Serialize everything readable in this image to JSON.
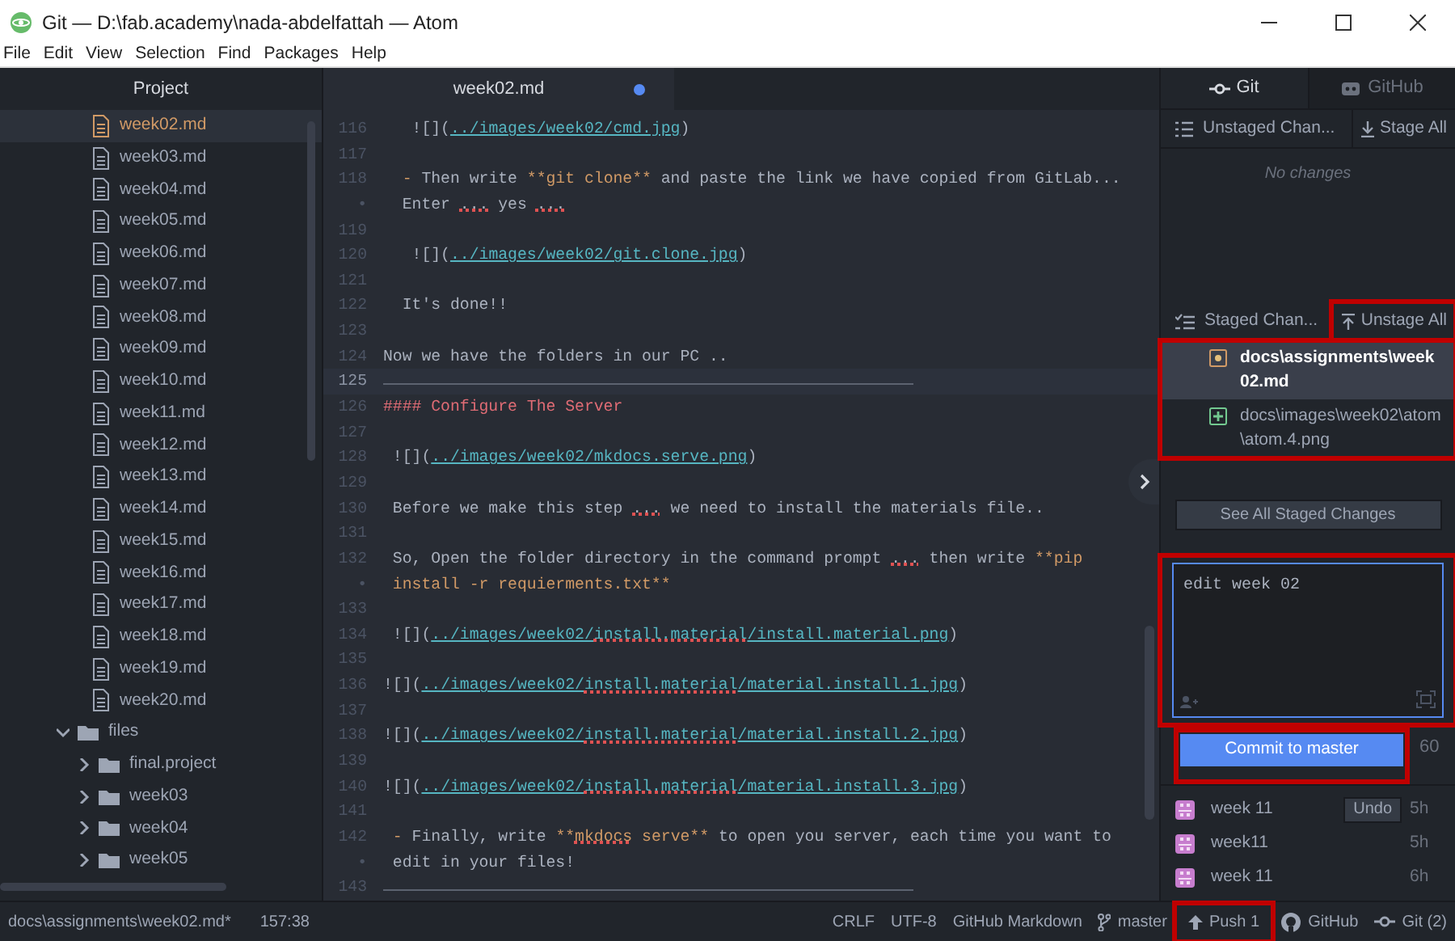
{
  "window": {
    "title": "Git — D:\\fab.academy\\nada-abdelfattah — Atom"
  },
  "menu": [
    "File",
    "Edit",
    "View",
    "Selection",
    "Find",
    "Packages",
    "Help"
  ],
  "project": {
    "title": "Project",
    "tree": [
      {
        "kind": "file",
        "label": "week02.md",
        "selected": true,
        "modified": true
      },
      {
        "kind": "file",
        "label": "week03.md",
        "selected": false,
        "modified": false
      },
      {
        "kind": "file",
        "label": "week04.md",
        "selected": false,
        "modified": false
      },
      {
        "kind": "file",
        "label": "week05.md",
        "selected": false,
        "modified": false
      },
      {
        "kind": "file",
        "label": "week06.md",
        "selected": false,
        "modified": false
      },
      {
        "kind": "file",
        "label": "week07.md",
        "selected": false,
        "modified": false
      },
      {
        "kind": "file",
        "label": "week08.md",
        "selected": false,
        "modified": false
      },
      {
        "kind": "file",
        "label": "week09.md",
        "selected": false,
        "modified": false
      },
      {
        "kind": "file",
        "label": "week10.md",
        "selected": false,
        "modified": false
      },
      {
        "kind": "file",
        "label": "week11.md",
        "selected": false,
        "modified": false
      },
      {
        "kind": "file",
        "label": "week12.md",
        "selected": false,
        "modified": false
      },
      {
        "kind": "file",
        "label": "week13.md",
        "selected": false,
        "modified": false
      },
      {
        "kind": "file",
        "label": "week14.md",
        "selected": false,
        "modified": false
      },
      {
        "kind": "file",
        "label": "week15.md",
        "selected": false,
        "modified": false
      },
      {
        "kind": "file",
        "label": "week16.md",
        "selected": false,
        "modified": false
      },
      {
        "kind": "file",
        "label": "week17.md",
        "selected": false,
        "modified": false
      },
      {
        "kind": "file",
        "label": "week18.md",
        "selected": false,
        "modified": false
      },
      {
        "kind": "file",
        "label": "week19.md",
        "selected": false,
        "modified": false
      },
      {
        "kind": "file",
        "label": "week20.md",
        "selected": false,
        "modified": false
      },
      {
        "kind": "folder",
        "label": "files",
        "expanded": true,
        "selected": false,
        "children": [
          {
            "kind": "folder",
            "label": "final.project",
            "expanded": false,
            "selected": false
          },
          {
            "kind": "folder",
            "label": "week03",
            "expanded": false,
            "selected": false
          },
          {
            "kind": "folder",
            "label": "week04",
            "expanded": false,
            "selected": false
          },
          {
            "kind": "folder",
            "label": "week05",
            "expanded": false,
            "selected": false
          }
        ]
      }
    ]
  },
  "editor": {
    "tab": {
      "label": "week02.md",
      "modified": true
    },
    "lines": [
      {
        "gutter": "116",
        "current": false,
        "segments": [
          {
            "kind": "text",
            "text": "   ![]("
          },
          {
            "kind": "link",
            "text": "../images/week02/cmd.jpg"
          },
          {
            "kind": "text",
            "text": ")"
          }
        ]
      },
      {
        "gutter": "117",
        "current": false
      },
      {
        "gutter": "118",
        "current": false,
        "segments": [
          {
            "kind": "accent",
            "text": "  -"
          },
          {
            "kind": "text",
            "text": " Then write "
          },
          {
            "kind": "accent",
            "text": "**git clone**"
          },
          {
            "kind": "text",
            "text": " and paste the link we have copied from GitLab..."
          }
        ]
      },
      {
        "gutter": "•",
        "current": false,
        "segments": [
          {
            "kind": "text",
            "text": "  Enter "
          },
          {
            "kind": "typo",
            "text": "..."
          },
          {
            "kind": "text",
            "text": " yes "
          },
          {
            "kind": "typo",
            "text": "..."
          }
        ]
      },
      {
        "gutter": "119",
        "current": false
      },
      {
        "gutter": "120",
        "current": false,
        "segments": [
          {
            "kind": "text",
            "text": "   ![]("
          },
          {
            "kind": "link",
            "text": "../images/week02/git.clone.jpg"
          },
          {
            "kind": "text",
            "text": ")"
          }
        ]
      },
      {
        "gutter": "121",
        "current": false
      },
      {
        "gutter": "122",
        "current": false,
        "segments": [
          {
            "kind": "text",
            "text": "  It's done!!"
          }
        ]
      },
      {
        "gutter": "123",
        "current": false
      },
      {
        "gutter": "124",
        "current": false,
        "segments": [
          {
            "kind": "text",
            "text": "Now we have the folders in our PC .."
          }
        ]
      },
      {
        "gutter": "125",
        "current": true,
        "kind": "rule"
      },
      {
        "gutter": "126",
        "current": false,
        "segments": [
          {
            "kind": "heading",
            "text": "#### Configure The Server"
          }
        ]
      },
      {
        "gutter": "127",
        "current": false
      },
      {
        "gutter": "128",
        "current": false,
        "segments": [
          {
            "kind": "text",
            "text": " ![]("
          },
          {
            "kind": "link",
            "text": "../images/week02/mkdocs.serve.png"
          },
          {
            "kind": "text",
            "text": ")"
          }
        ]
      },
      {
        "gutter": "129",
        "current": false
      },
      {
        "gutter": "130",
        "current": false,
        "segments": [
          {
            "kind": "text",
            "text": " Before we make this step "
          },
          {
            "kind": "typo",
            "text": "..."
          },
          {
            "kind": "text",
            "text": " we need to install the materials file.."
          }
        ]
      },
      {
        "gutter": "131",
        "current": false
      },
      {
        "gutter": "132",
        "current": false,
        "segments": [
          {
            "kind": "text",
            "text": " So, Open the folder directory in the command prompt "
          },
          {
            "kind": "typo",
            "text": "..."
          },
          {
            "kind": "text",
            "text": " then write "
          },
          {
            "kind": "accent",
            "text": "**pip"
          }
        ]
      },
      {
        "gutter": "•",
        "current": false,
        "segments": [
          {
            "kind": "accent",
            "text": " install -r requierments.txt**"
          }
        ]
      },
      {
        "gutter": "133",
        "current": false
      },
      {
        "gutter": "134",
        "current": false,
        "segments": [
          {
            "kind": "text",
            "text": " ![]("
          },
          {
            "kind": "link",
            "text": "../images/week02/"
          },
          {
            "kind": "link_typo",
            "text": "install.material"
          },
          {
            "kind": "link",
            "text": "/install.material.png"
          },
          {
            "kind": "text",
            "text": ")"
          }
        ]
      },
      {
        "gutter": "135",
        "current": false
      },
      {
        "gutter": "136",
        "current": false,
        "segments": [
          {
            "kind": "text",
            "text": "![]("
          },
          {
            "kind": "link",
            "text": "../images/week02/"
          },
          {
            "kind": "link_typo",
            "text": "install.material"
          },
          {
            "kind": "link",
            "text": "/material.install.1.jpg"
          },
          {
            "kind": "text",
            "text": ")"
          }
        ]
      },
      {
        "gutter": "137",
        "current": false
      },
      {
        "gutter": "138",
        "current": false,
        "segments": [
          {
            "kind": "text",
            "text": "![]("
          },
          {
            "kind": "link",
            "text": "../images/week02/"
          },
          {
            "kind": "link_typo",
            "text": "install.material"
          },
          {
            "kind": "link",
            "text": "/material.install.2.jpg"
          },
          {
            "kind": "text",
            "text": ")"
          }
        ]
      },
      {
        "gutter": "139",
        "current": false
      },
      {
        "gutter": "140",
        "current": false,
        "segments": [
          {
            "kind": "text",
            "text": "![]("
          },
          {
            "kind": "link",
            "text": "../images/week02/"
          },
          {
            "kind": "link_typo",
            "text": "install.material"
          },
          {
            "kind": "link",
            "text": "/material.install.3.jpg"
          },
          {
            "kind": "text",
            "text": ")"
          }
        ]
      },
      {
        "gutter": "141",
        "current": false
      },
      {
        "gutter": "142",
        "current": false,
        "segments": [
          {
            "kind": "accent",
            "text": " -"
          },
          {
            "kind": "text",
            "text": " Finally, write "
          },
          {
            "kind": "accent",
            "text": "**"
          },
          {
            "kind": "accent_typo",
            "text": "mkdocs"
          },
          {
            "kind": "accent",
            "text": " serve**"
          },
          {
            "kind": "text",
            "text": " to open you server, each time you want to"
          }
        ]
      },
      {
        "gutter": "•",
        "current": false,
        "segments": [
          {
            "kind": "text",
            "text": " edit in your files!"
          }
        ]
      },
      {
        "gutter": "143",
        "current": false,
        "kind": "rule"
      }
    ]
  },
  "git_panel": {
    "tabs": [
      {
        "label": "Git",
        "kind": "git",
        "selected": true
      },
      {
        "label": "GitHub",
        "kind": "github",
        "selected": false
      }
    ],
    "unstaged": {
      "title": "Unstaged Chan...",
      "action": {
        "label": "Stage All",
        "highlighted": false
      },
      "empty_text": "No changes"
    },
    "staged": {
      "title": "Staged Chan...",
      "action": {
        "label": "Unstage All",
        "highlighted": true
      },
      "highlighted": true,
      "files": [
        {
          "path": "docs\\assignments\\week02.md",
          "kind": "modified",
          "selected": true
        },
        {
          "path": "docs\\images\\week02\\atom\\atom.4.png",
          "kind": "added",
          "selected": false
        }
      ]
    },
    "see_all": "See All Staged Changes",
    "commit_message": {
      "value": "edit week 02",
      "highlighted": true
    },
    "commit_button": {
      "label": "Commit to master",
      "highlighted": true
    },
    "remaining": "60",
    "recent_commits": [
      {
        "message": "week 11",
        "time": "5h",
        "undo": "Undo"
      },
      {
        "message": "week11",
        "time": "5h"
      },
      {
        "message": "week 11",
        "time": "6h"
      }
    ]
  },
  "status_bar": {
    "path": "docs\\assignments\\week02.md*",
    "cursor": "157:38",
    "line_ending": "CRLF",
    "encoding": "UTF-8",
    "grammar": "GitHub Markdown",
    "branch": "master",
    "push": {
      "label": "Push 1",
      "highlighted": true
    },
    "github": "GitHub",
    "git": "Git (2)"
  }
}
